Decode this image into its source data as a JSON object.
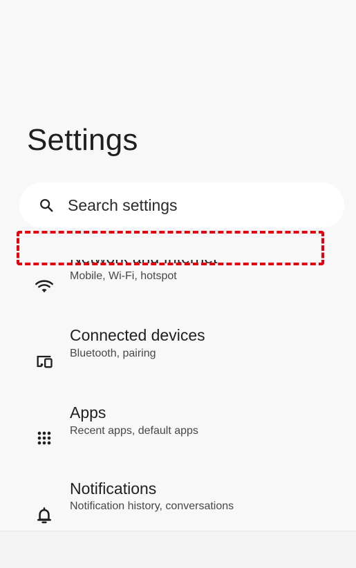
{
  "page": {
    "title": "Settings"
  },
  "search": {
    "placeholder": "Search settings",
    "icon": "search-icon"
  },
  "items": [
    {
      "title": "Network and Internet",
      "subtitle": "Mobile, Wi-Fi, hotspot",
      "icon": "wifi-icon"
    },
    {
      "title": "Connected devices",
      "subtitle": "Bluetooth, pairing",
      "icon": "connected-devices-icon"
    },
    {
      "title": "Apps",
      "subtitle": "Recent apps, default apps",
      "icon": "apps-grid-icon"
    },
    {
      "title": "Notifications",
      "subtitle": "Notification history, conversations",
      "icon": "bell-icon"
    }
  ],
  "colors": {
    "background": "#f8f8f8",
    "search_background": "#ffffff",
    "text_primary": "#1f1f1f",
    "text_secondary": "#474747",
    "highlight": "#e4000f"
  }
}
